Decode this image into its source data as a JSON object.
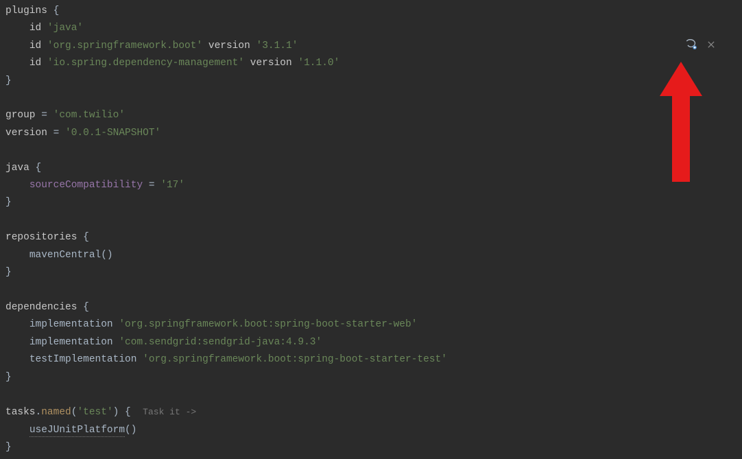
{
  "code": {
    "plugins_block": {
      "keyword": "plugins",
      "open": " {",
      "lines": [
        {
          "indent": "    ",
          "kw": "id",
          "sp": " ",
          "str": "'java'"
        },
        {
          "indent": "    ",
          "kw": "id",
          "sp": " ",
          "str": "'org.springframework.boot'",
          "mid": " version ",
          "str2": "'3.1.1'"
        },
        {
          "indent": "    ",
          "kw": "id",
          "sp": " ",
          "str": "'io.spring.dependency-management'",
          "mid": " version ",
          "str2": "'1.1.0'"
        }
      ],
      "close": "}"
    },
    "group": {
      "kw": "group",
      "eq": " = ",
      "val": "'com.twilio'"
    },
    "version": {
      "kw": "version",
      "eq": " = ",
      "val": "'0.0.1-SNAPSHOT'"
    },
    "java_block": {
      "keyword": "java",
      "open": " {",
      "line": {
        "indent": "    ",
        "prop": "sourceCompatibility",
        "eq": " = ",
        "val": "'17'"
      },
      "close": "}"
    },
    "repos_block": {
      "keyword": "repositories",
      "open": " {",
      "line": {
        "indent": "    ",
        "fn": "mavenCentral",
        "paren": "()"
      },
      "close": "}"
    },
    "deps_block": {
      "keyword": "dependencies",
      "open": " {",
      "lines": [
        {
          "indent": "    ",
          "fn": "implementation",
          "sp": " ",
          "str": "'org.springframework.boot:spring-boot-starter-web'"
        },
        {
          "indent": "    ",
          "fn": "implementation",
          "sp": " ",
          "str": "'com.sendgrid:sendgrid-java:4.9.3'"
        },
        {
          "indent": "    ",
          "fn": "testImplementation",
          "sp": " ",
          "str": "'org.springframework.boot:spring-boot-starter-test'"
        }
      ],
      "close": "}"
    },
    "tasks_block": {
      "kw": "tasks",
      "dot": ".",
      "named": "named",
      "open_paren": "(",
      "arg": "'test'",
      "close_paren": ")",
      "brace": " {",
      "hint_pre": "  ",
      "hint": "Task it ->",
      "line": {
        "indent": "    ",
        "fn": "useJUnitPlatform",
        "paren": "()"
      },
      "close": "}"
    }
  },
  "icons": {
    "refresh_title": "Load Gradle Changes",
    "close_title": "Close"
  },
  "arrow_color": "#e61b1b"
}
